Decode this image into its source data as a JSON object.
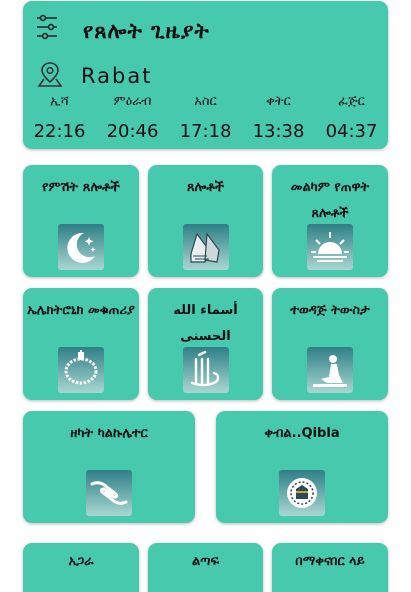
{
  "header": {
    "title": "የጸሎት ጊዜያት",
    "city": "Rabat",
    "prayers": [
      {
        "name": "ኢሻ",
        "time": "22:16"
      },
      {
        "name": "ምዕራብ",
        "time": "20:46"
      },
      {
        "name": "አስር",
        "time": "17:18"
      },
      {
        "name": "ቀትር",
        "time": "13:38"
      },
      {
        "name": "ፈጅር",
        "time": "04:37"
      }
    ]
  },
  "tiles": [
    {
      "label": "የምሽት ጸሎቶች",
      "icon": "moon-stars-icon"
    },
    {
      "label": "ጸሎቶች",
      "icon": "praying-hands-icon"
    },
    {
      "label": "መልካም የጠዋት ጸሎቶች",
      "icon": "sunrise-icon"
    },
    {
      "label": "ኤሌክትሮኒክ መቁጠሪያ",
      "icon": "prayer-beads-icon"
    },
    {
      "label": "أسماء الله الحسنى",
      "icon": "allah-calligraphy-icon"
    },
    {
      "label": "ተወዳጅ ትውስታ",
      "icon": "person-praying-icon"
    },
    {
      "label": "ዘካት ካልኩሌተር",
      "icon": "giving-hands-icon"
    },
    {
      "label": "ቀብል..Qibla",
      "icon": "qibla-compass-icon"
    }
  ],
  "bottom": [
    {
      "label": "አጋራ"
    },
    {
      "label": "ልጣፍ"
    },
    {
      "label": "በማቀናበር ላይ"
    }
  ],
  "colors": {
    "card": "#47c9ad",
    "icon_bg_top": "#2f7f86",
    "icon_bg_bottom": "#a9d7d2"
  }
}
